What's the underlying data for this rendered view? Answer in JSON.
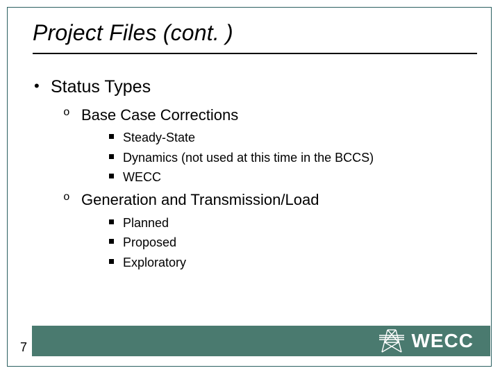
{
  "slide": {
    "title": "Project Files (cont. )",
    "page_number": "7",
    "brand": {
      "name": "WECC",
      "bar_color": "#4a7a6f"
    }
  },
  "content": {
    "level1": [
      {
        "text": "Status Types",
        "level2": [
          {
            "text": "Base Case Corrections",
            "level3": [
              {
                "text": "Steady-State"
              },
              {
                "text": "Dynamics (not used at this time in the BCCS)"
              },
              {
                "text": "WECC"
              }
            ]
          },
          {
            "text": "Generation and Transmission/Load",
            "level3": [
              {
                "text": "Planned"
              },
              {
                "text": "Proposed"
              },
              {
                "text": "Exploratory"
              }
            ]
          }
        ]
      }
    ]
  }
}
